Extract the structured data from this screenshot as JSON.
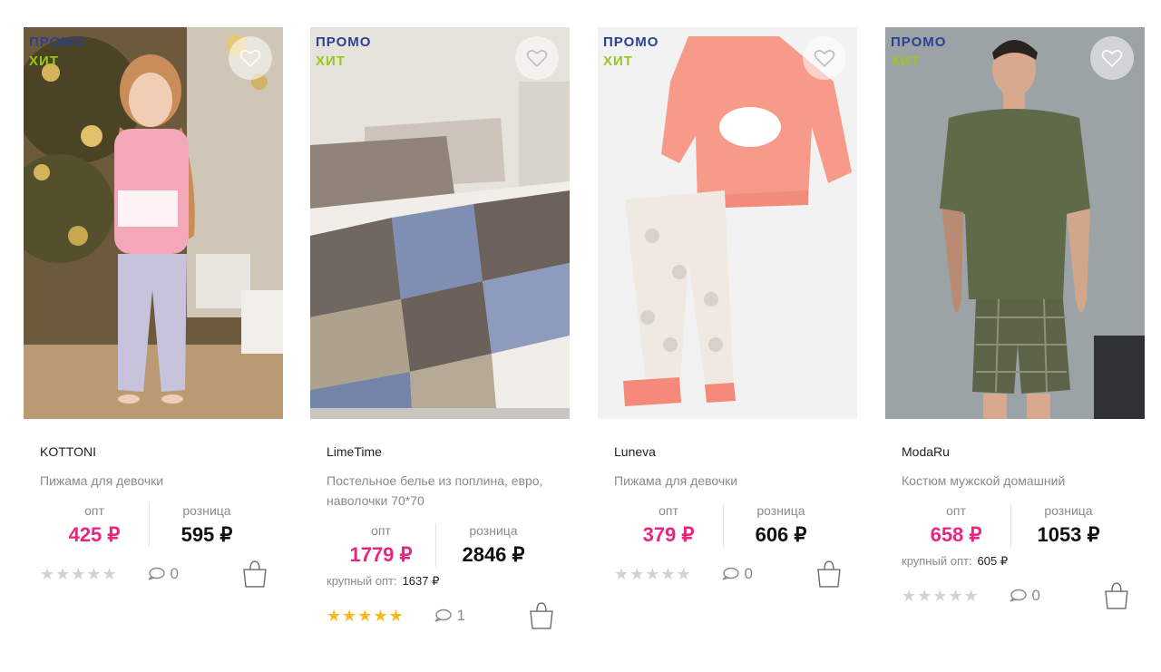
{
  "badges": {
    "promo": "ПРОМО",
    "hit": "ХИТ"
  },
  "labels": {
    "opt": "опт",
    "retail": "розница",
    "bulk": "крупный опт:"
  },
  "colors": {
    "promo": "#2b3f95",
    "hit": "#9bc61d",
    "opt_price": "#e9257f",
    "star_active": "#f7b91c",
    "star_inactive": "#d2d2d2"
  },
  "products": [
    {
      "brand": "KOTTONI",
      "title": "Пижама для девочки",
      "opt_price": "425 ₽",
      "retail_price": "595 ₽",
      "bulk_price": "",
      "rating": 0,
      "rating_stars": "★★★★★",
      "comments": "0"
    },
    {
      "brand": "LimeTime",
      "title": "Постельное белье из поплина, евро, наволочки 70*70",
      "opt_price": "1779 ₽",
      "retail_price": "2846 ₽",
      "bulk_price": "1637 ₽",
      "rating": 5,
      "rating_stars": "★★★★★",
      "comments": "1"
    },
    {
      "brand": "Luneva",
      "title": "Пижама для девочки",
      "opt_price": "379 ₽",
      "retail_price": "606 ₽",
      "bulk_price": "",
      "rating": 0,
      "rating_stars": "★★★★★",
      "comments": "0"
    },
    {
      "brand": "ModaRu",
      "title": "Костюм мужской домашний",
      "opt_price": "658 ₽",
      "retail_price": "1053 ₽",
      "bulk_price": "605 ₽",
      "rating": 0,
      "rating_stars": "★★★★★",
      "comments": "0"
    }
  ]
}
